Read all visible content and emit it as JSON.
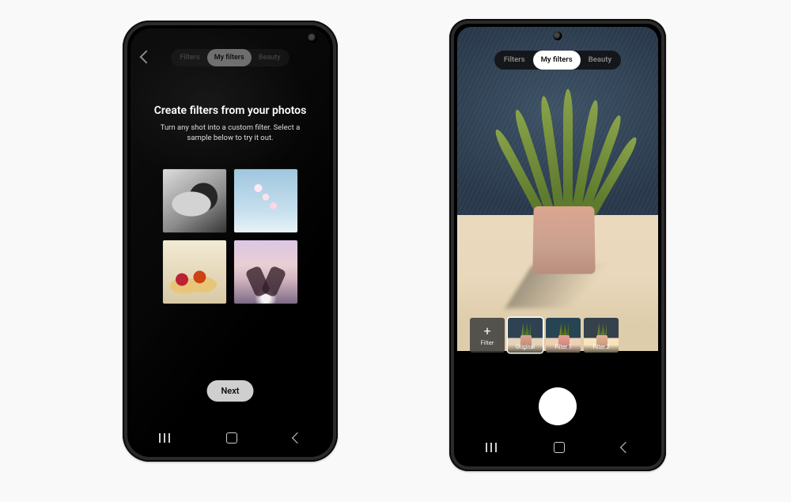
{
  "phone_left": {
    "back_label": "Back",
    "tabs": {
      "filters": "Filters",
      "my_filters": "My filters",
      "beauty": "Beauty"
    },
    "title": "Create filters from your photos",
    "subtitle": "Turn any shot into a custom filter. Select a sample below to try it out.",
    "samples": [
      {
        "name": "sample-bw-bowl"
      },
      {
        "name": "sample-blossom"
      },
      {
        "name": "sample-tarts"
      },
      {
        "name": "sample-beach"
      }
    ],
    "next_label": "Next",
    "nav": {
      "recent": "Recent apps",
      "home": "Home",
      "back": "Back"
    }
  },
  "phone_right": {
    "tabs": {
      "filters": "Filters",
      "my_filters": "My filters",
      "beauty": "Beauty"
    },
    "filters_strip": {
      "add": {
        "plus": "+",
        "label": "Filter"
      },
      "items": [
        {
          "label": "Original",
          "selected": true
        },
        {
          "label": "Filter 1"
        },
        {
          "label": "Filter 2"
        }
      ]
    },
    "shutter_label": "Shutter",
    "nav": {
      "recent": "Recent apps",
      "home": "Home",
      "back": "Back"
    }
  }
}
